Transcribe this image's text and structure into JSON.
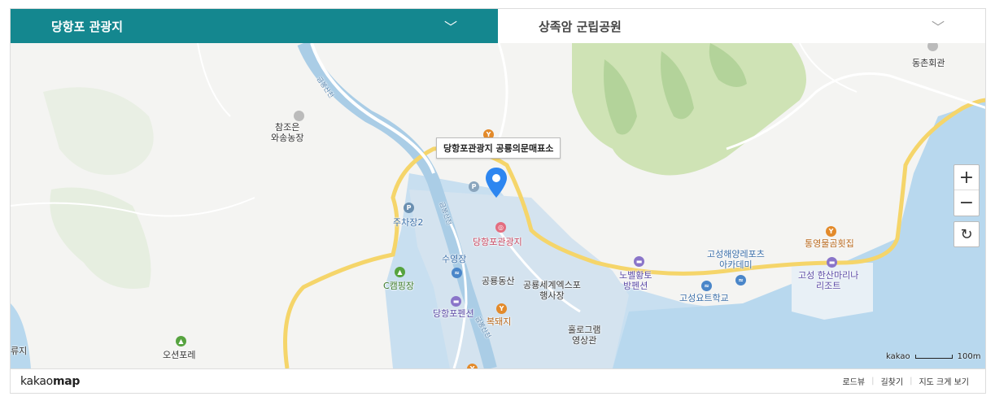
{
  "tabs": [
    {
      "label": "당항포 관광지",
      "active": true
    },
    {
      "label": "상족암 군립공원",
      "active": false
    }
  ],
  "colors": {
    "accent": "#14878f",
    "sea": "#b8d8ee",
    "road": "#f5d56a",
    "park": "#cfe3b5"
  },
  "map": {
    "callout": "당항포관광지 공룡의문매표소",
    "labels": [
      {
        "text": "참조은\n와송농장"
      },
      {
        "text": "주차장2"
      },
      {
        "text": "당항포관광지"
      },
      {
        "text": "수영장"
      },
      {
        "text": "C캠핑장"
      },
      {
        "text": "공룡동산"
      },
      {
        "text": "공룡세계엑스포\n행사장"
      },
      {
        "text": "당항포펜션"
      },
      {
        "text": "복돼지"
      },
      {
        "text": "홀로그램\n영상관"
      },
      {
        "text": "노벨황토\n방펜션"
      },
      {
        "text": "고성해양레포츠\n아카데미"
      },
      {
        "text": "고성요트학교"
      },
      {
        "text": "통영물곰횟집"
      },
      {
        "text": "고성 한산마리나\n리조트"
      },
      {
        "text": "동촌회관"
      },
      {
        "text": "오션포레"
      },
      {
        "text": "류지"
      }
    ],
    "road_labels": [
      {
        "text": "금봉산천"
      },
      {
        "text": "금봉산천"
      },
      {
        "text": "금봉산천"
      }
    ],
    "scale": {
      "brand": "kakao",
      "distance": "100m"
    }
  },
  "controls": {
    "zoom_in": "+",
    "zoom_out": "−",
    "refresh": "↻"
  },
  "footer": {
    "logo_light": "kakao",
    "logo_bold": "map",
    "links": [
      "로드뷰",
      "길찾기",
      "지도 크게 보기"
    ]
  }
}
